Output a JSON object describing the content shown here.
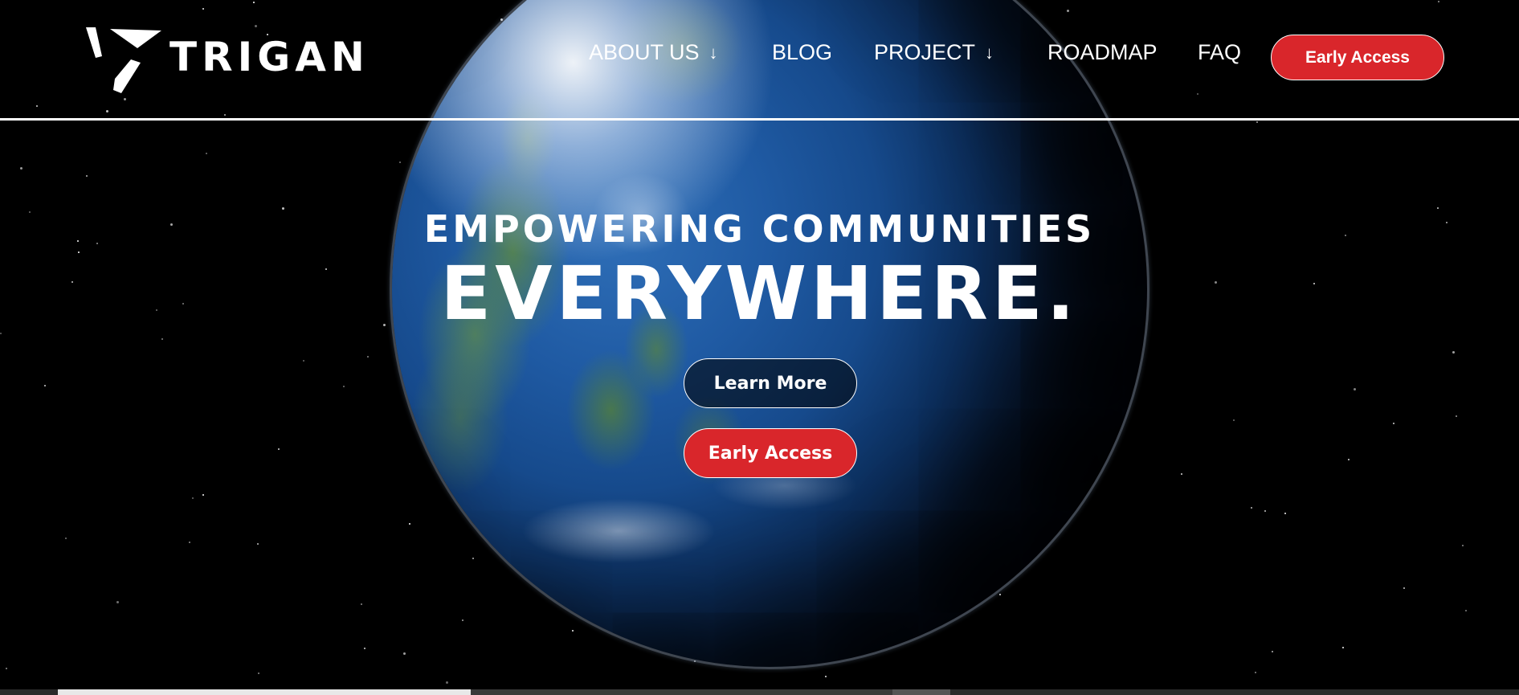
{
  "brand": {
    "logo_text": "TRIGAN",
    "logo_icon": "trigan-triangle-icon"
  },
  "nav": {
    "items": [
      {
        "label": "ABOUT US",
        "has_dropdown": true
      },
      {
        "label": "BLOG",
        "has_dropdown": false
      },
      {
        "label": "PROJECT",
        "has_dropdown": true
      },
      {
        "label": "ROADMAP",
        "has_dropdown": false
      },
      {
        "label": "FAQ",
        "has_dropdown": false
      }
    ],
    "dropdown_arrow": "↓",
    "cta_label": "Early Access"
  },
  "hero": {
    "subtitle": "EMPOWERING COMMUNITIES",
    "title": "EVERYWHERE.",
    "learn_more_label": "Learn More",
    "early_access_label": "Early Access"
  },
  "colors": {
    "accent": "#d9262b",
    "background": "#000000",
    "text": "#ffffff"
  }
}
